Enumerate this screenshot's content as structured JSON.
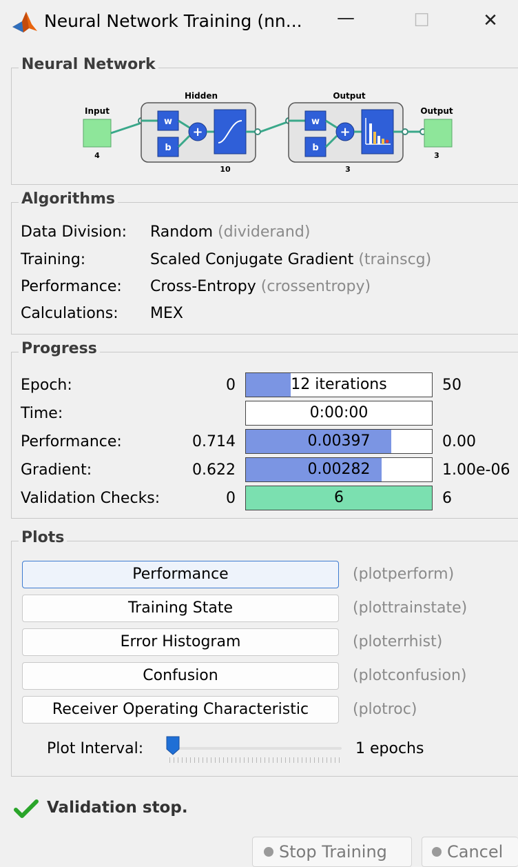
{
  "window": {
    "title": "Neural Network Training (nn...",
    "minimize_glyph": "—",
    "maximize_glyph": "☐",
    "close_glyph": "✕"
  },
  "network": {
    "legend": "Neural Network",
    "input_label": "Input",
    "input_size": "4",
    "hidden_label": "Hidden",
    "hidden_size": "10",
    "output_layer_label": "Output",
    "output_layer_size": "3",
    "output_label": "Output",
    "output_size": "3",
    "weight_label": "w",
    "bias_label": "b"
  },
  "algorithms": {
    "legend": "Algorithms",
    "rows": [
      {
        "label": "Data Division:",
        "value": "Random",
        "fn": "(dividerand)"
      },
      {
        "label": "Training:",
        "value": "Scaled Conjugate Gradient",
        "fn": "(trainscg)"
      },
      {
        "label": "Performance:",
        "value": "Cross-Entropy",
        "fn": "(crossentropy)"
      },
      {
        "label": "Calculations:",
        "value": "MEX",
        "fn": ""
      }
    ]
  },
  "progress": {
    "legend": "Progress",
    "rows": [
      {
        "label": "Epoch:",
        "start": "0",
        "bar_text": "12 iterations",
        "end": "50",
        "fill": 0.24
      },
      {
        "label": "Time:",
        "start": "",
        "bar_text": "0:00:00",
        "end": "",
        "fill": 0.0
      },
      {
        "label": "Performance:",
        "start": "0.714",
        "bar_text": "0.00397",
        "end": "0.00",
        "fill": 0.78
      },
      {
        "label": "Gradient:",
        "start": "0.622",
        "bar_text": "0.00282",
        "end": "1.00e-06",
        "fill": 0.73
      },
      {
        "label": "Validation Checks:",
        "start": "0",
        "bar_text": "6",
        "end": "6",
        "fill": 1.0
      }
    ]
  },
  "plots": {
    "legend": "Plots",
    "buttons": [
      {
        "label": "Performance",
        "fn": "(plotperform)"
      },
      {
        "label": "Training State",
        "fn": "(plottrainstate)"
      },
      {
        "label": "Error Histogram",
        "fn": "(ploterrhist)"
      },
      {
        "label": "Confusion",
        "fn": "(plotconfusion)"
      },
      {
        "label": "Receiver Operating Characteristic",
        "fn": "(plotroc)"
      }
    ],
    "interval_label": "Plot Interval:",
    "interval_value": "1 epochs",
    "interval_level": 0.0
  },
  "status": {
    "text": "Validation stop."
  },
  "actions": {
    "stop_label": "Stop Training",
    "cancel_label": "Cancel"
  },
  "colors": {
    "bar_blue": "#7b95e3",
    "bar_green": "#7be0b0",
    "node_green": "#8ee69a",
    "node_blue": "#2f5fd8",
    "check_green": "#2aa52a",
    "slider_blue": "#1f6fd6"
  }
}
